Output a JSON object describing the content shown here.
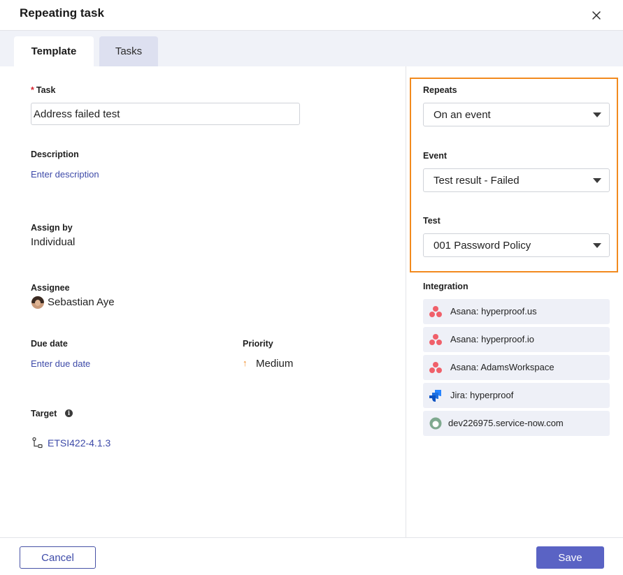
{
  "dialog": {
    "title": "Repeating task",
    "close_icon": "close-icon"
  },
  "tabs": [
    {
      "label": "Template",
      "active": true
    },
    {
      "label": "Tasks",
      "active": false
    }
  ],
  "form": {
    "task": {
      "label": "Task",
      "required_mark": "*",
      "value": "Address failed test"
    },
    "description": {
      "label": "Description",
      "placeholder": "Enter description"
    },
    "assign_by": {
      "label": "Assign by",
      "value": "Individual"
    },
    "assignee": {
      "label": "Assignee",
      "value": "Sebastian Aye"
    },
    "due_date": {
      "label": "Due date",
      "placeholder": "Enter due date"
    },
    "priority": {
      "label": "Priority",
      "value": "Medium",
      "icon": "arrow-up-icon",
      "color": "#f08a24"
    },
    "target": {
      "label": "Target",
      "value": "ETSI422-4.1.3",
      "info_icon": "info-icon",
      "icon": "hierarchy-icon"
    }
  },
  "schedule": {
    "repeats": {
      "label": "Repeats",
      "value": "On an event"
    },
    "event": {
      "label": "Event",
      "value": "Test result - Failed"
    },
    "test": {
      "label": "Test",
      "value": "001 Password Policy"
    },
    "highlight_color": "#f28a1e"
  },
  "integration": {
    "label": "Integration",
    "items": [
      {
        "label": "Asana: hyperproof.us",
        "icon": "asana-icon"
      },
      {
        "label": "Asana: hyperproof.io",
        "icon": "asana-icon"
      },
      {
        "label": "Asana: AdamsWorkspace",
        "icon": "asana-icon"
      },
      {
        "label": "Jira: hyperproof",
        "icon": "jira-icon"
      },
      {
        "label": "dev226975.service-now.com",
        "icon": "servicenow-icon"
      }
    ]
  },
  "footer": {
    "cancel_label": "Cancel",
    "save_label": "Save",
    "accent_color": "#5a63c4"
  }
}
